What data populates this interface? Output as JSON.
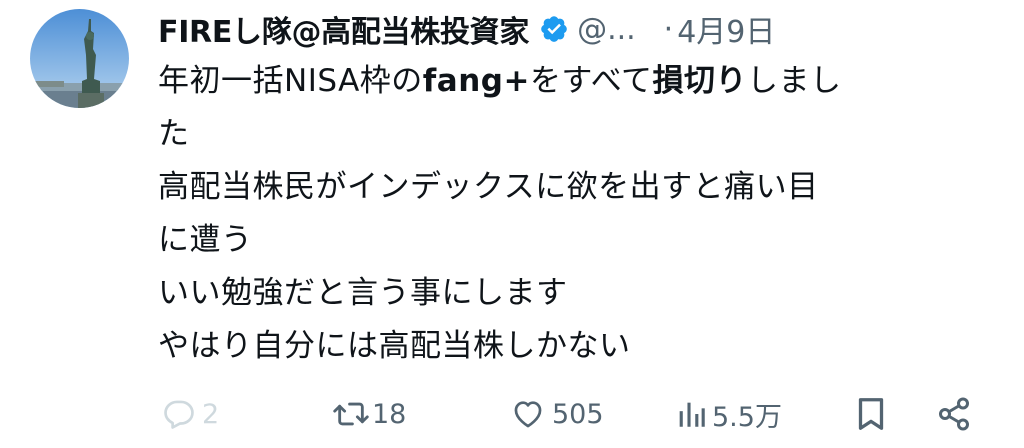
{
  "tweet": {
    "display_name": "FIREし隊@高配当株投資家",
    "handle": "@...",
    "separator": "·",
    "date": "4月9日",
    "verified_icon": "verified-badge-icon",
    "avatar": "statue-of-liberty-photo",
    "lines": [
      [
        "年初一括NISA枠の",
        "fang+",
        "をすべて",
        "損切り",
        "しまし"
      ],
      [
        "た"
      ],
      [
        "高配当株民がインデックスに欲を出すと痛い目"
      ],
      [
        "に遭う"
      ],
      [
        "いい勉強だと言う事にします"
      ],
      [
        "やはり自分には高配当株しかない"
      ]
    ]
  },
  "actions": {
    "reply_count": "2",
    "retweet_count": "18",
    "like_count": "505",
    "views_count": "5.5万"
  },
  "colors": {
    "text": "#0f1419",
    "secondary": "#536471",
    "reply_faded": "#cfd9de",
    "verified": "#1d9bf0"
  }
}
